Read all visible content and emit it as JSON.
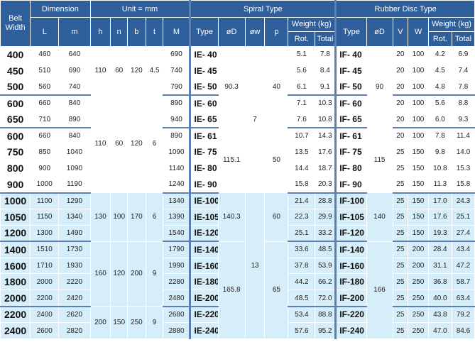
{
  "header": {
    "belt_width": "Belt Width",
    "dimension": "Dimension",
    "unit": "Unit = mm",
    "spiral_type": "Spiral Type",
    "rubber_disc_type": "Rubber Disc Type",
    "weight": "Weight (kg)",
    "type": "Type",
    "od": "øD",
    "ow": "øw",
    "p": "p",
    "v": "V",
    "w": "W",
    "rot": "Rot.",
    "total": "Total",
    "cols_dim": [
      "L",
      "m",
      "h",
      "n",
      "b",
      "t",
      "M"
    ]
  },
  "rows": [
    {
      "bw": "400",
      "L": "460",
      "m": "640",
      "M": "690",
      "st": "IE- 40",
      "s_rot": "5.1",
      "s_tot": "7.8",
      "rt": "IF- 40",
      "V": "20",
      "W": "100",
      "r_rot": "4.2",
      "r_tot": "6.9"
    },
    {
      "bw": "450",
      "L": "510",
      "m": "690",
      "M": "740",
      "st": "IE- 45",
      "s_rot": "5.6",
      "s_tot": "8.4",
      "rt": "IF- 45",
      "V": "20",
      "W": "100",
      "r_rot": "4.5",
      "r_tot": "7.4"
    },
    {
      "bw": "500",
      "L": "560",
      "m": "740",
      "M": "790",
      "st": "IE- 50",
      "s_rot": "6.1",
      "s_tot": "9.1",
      "rt": "IF- 50",
      "V": "20",
      "W": "100",
      "r_rot": "4.8",
      "r_tot": "7.8"
    },
    {
      "bw": "600",
      "L": "660",
      "m": "840",
      "M": "890",
      "st": "IE- 60",
      "s_rot": "7.1",
      "s_tot": "10.3",
      "rt": "IF- 60",
      "V": "20",
      "W": "100",
      "r_rot": "5.6",
      "r_tot": "8.8"
    },
    {
      "bw": "650",
      "L": "710",
      "m": "890",
      "M": "940",
      "st": "IE- 65",
      "s_rot": "7.6",
      "s_tot": "10.8",
      "rt": "IF- 65",
      "V": "20",
      "W": "100",
      "r_rot": "6.0",
      "r_tot": "9.3"
    },
    {
      "bw": "600",
      "L": "660",
      "m": "840",
      "M": "890",
      "st": "IE- 61",
      "s_rot": "10.7",
      "s_tot": "14.3",
      "rt": "IF- 61",
      "V": "20",
      "W": "100",
      "r_rot": "7.8",
      "r_tot": "11.4"
    },
    {
      "bw": "750",
      "L": "850",
      "m": "1040",
      "M": "1090",
      "st": "IE- 75",
      "s_rot": "13.5",
      "s_tot": "17.6",
      "rt": "IF- 75",
      "V": "25",
      "W": "150",
      "r_rot": "9.8",
      "r_tot": "14.0"
    },
    {
      "bw": "800",
      "L": "900",
      "m": "1090",
      "M": "1140",
      "st": "IE- 80",
      "s_rot": "14.4",
      "s_tot": "18.7",
      "rt": "IF- 80",
      "V": "25",
      "W": "150",
      "r_rot": "10.8",
      "r_tot": "15.3"
    },
    {
      "bw": "900",
      "L": "1000",
      "m": "1190",
      "M": "1240",
      "st": "IE- 90",
      "s_rot": "15.8",
      "s_tot": "20.3",
      "rt": "IF- 90",
      "V": "25",
      "W": "150",
      "r_rot": "11.3",
      "r_tot": "15.8"
    },
    {
      "bw": "1000",
      "L": "1100",
      "m": "1290",
      "M": "1340",
      "st": "IE-100",
      "s_rot": "21.4",
      "s_tot": "28.8",
      "rt": "IF-100",
      "V": "25",
      "W": "150",
      "r_rot": "17.0",
      "r_tot": "24.3"
    },
    {
      "bw": "1050",
      "L": "1150",
      "m": "1340",
      "M": "1390",
      "st": "IE-105",
      "s_rot": "22.3",
      "s_tot": "29.9",
      "rt": "IF-105",
      "V": "25",
      "W": "150",
      "r_rot": "17.6",
      "r_tot": "25.1"
    },
    {
      "bw": "1200",
      "L": "1300",
      "m": "1490",
      "M": "1540",
      "st": "IE-120",
      "s_rot": "25.1",
      "s_tot": "33.2",
      "rt": "IF-120",
      "V": "25",
      "W": "150",
      "r_rot": "19.3",
      "r_tot": "27.4"
    },
    {
      "bw": "1400",
      "L": "1510",
      "m": "1730",
      "M": "1790",
      "st": "IE-140",
      "s_rot": "33.6",
      "s_tot": "48.5",
      "rt": "IF-140",
      "V": "25",
      "W": "200",
      "r_rot": "28.4",
      "r_tot": "43.4"
    },
    {
      "bw": "1600",
      "L": "1710",
      "m": "1930",
      "M": "1990",
      "st": "IE-160",
      "s_rot": "37.8",
      "s_tot": "53.9",
      "rt": "IF-160",
      "V": "25",
      "W": "200",
      "r_rot": "31.1",
      "r_tot": "47.2"
    },
    {
      "bw": "1800",
      "L": "2000",
      "m": "2220",
      "M": "2280",
      "st": "IE-180",
      "s_rot": "44.2",
      "s_tot": "66.2",
      "rt": "IF-180",
      "V": "25",
      "W": "250",
      "r_rot": "36.8",
      "r_tot": "58.7"
    },
    {
      "bw": "2000",
      "L": "2200",
      "m": "2420",
      "M": "2480",
      "st": "IE-200",
      "s_rot": "48.5",
      "s_tot": "72.0",
      "rt": "IF-200",
      "V": "25",
      "W": "250",
      "r_rot": "40.0",
      "r_tot": "63.4"
    },
    {
      "bw": "2200",
      "L": "2400",
      "m": "2620",
      "M": "2680",
      "st": "IE-220",
      "s_rot": "53.4",
      "s_tot": "88.8",
      "rt": "IF-220",
      "V": "25",
      "W": "250",
      "r_rot": "43.8",
      "r_tot": "79.2"
    },
    {
      "bw": "2400",
      "L": "2600",
      "m": "2820",
      "M": "2880",
      "st": "IE-240",
      "s_rot": "57.6",
      "s_tot": "95.2",
      "rt": "IF-240",
      "V": "25",
      "W": "250",
      "r_rot": "47.0",
      "r_tot": "84.6"
    }
  ],
  "groups": {
    "h": [
      "110",
      "110",
      "130",
      "160",
      "200"
    ],
    "n": [
      "60",
      "60",
      "100",
      "120",
      "150"
    ],
    "b": [
      "120",
      "120",
      "170",
      "200",
      "250"
    ],
    "t": [
      "4.5",
      "6",
      "6",
      "9",
      "9"
    ],
    "od": [
      "90.3",
      "115.1",
      "140.3",
      "165.8"
    ],
    "ow": [
      "7",
      "13"
    ],
    "p": [
      "40",
      "50",
      "60",
      "65"
    ],
    "rod": [
      "90",
      "115",
      "140",
      "166"
    ]
  }
}
